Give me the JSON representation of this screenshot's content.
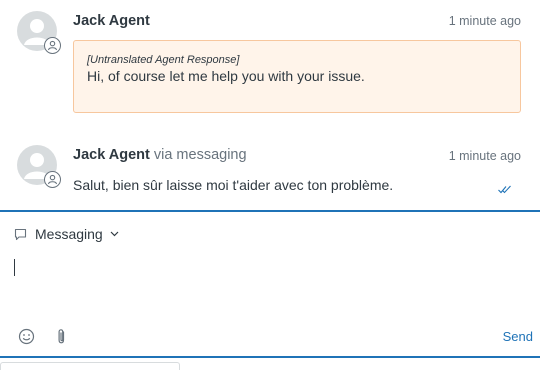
{
  "messages": [
    {
      "author": "Jack Agent",
      "via": "",
      "time": "1 minute ago",
      "tag": "[Untranslated Agent Response]",
      "text": "Hi, of course let me help you with your issue."
    },
    {
      "author": "Jack Agent",
      "via": "via messaging",
      "time": "1 minute ago",
      "text": "Salut, bien sûr laisse moi t'aider avec ton problème."
    }
  ],
  "composer": {
    "channel_label": "Messaging",
    "send_label": "Send"
  },
  "icons": {
    "channel": "speech-bubble-icon",
    "channel_menu": "chevron-down-icon",
    "emoji": "emoji-icon",
    "attach": "paperclip-icon",
    "read_receipt": "double-check-icon",
    "agent_badge": "agent-badge-icon"
  },
  "colors": {
    "accent": "#1f73b7",
    "note_bg": "#fff4ea",
    "note_border": "#f7c79e",
    "muted": "#68737d"
  }
}
